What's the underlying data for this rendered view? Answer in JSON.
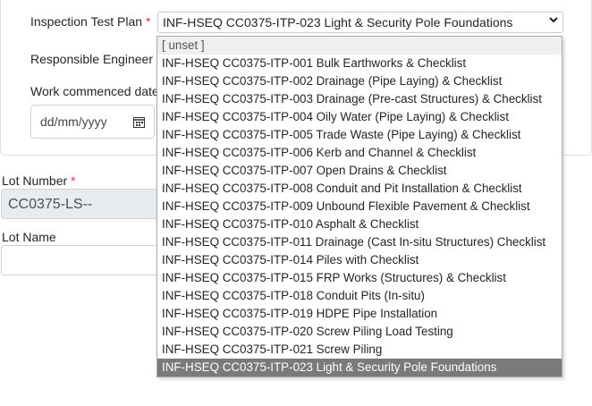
{
  "form": {
    "itp_label": "Inspection Test Plan",
    "required_mark": "*",
    "itp_value": "INF-HSEQ CC0375-ITP-023 Light & Security Pole Foundations",
    "engineer_label": "Responsible Engineer",
    "work_label": "Work commenced date",
    "date_placeholder": "dd/mm/yyyy",
    "lot_number_label": "Lot Number",
    "lot_number_value": "CC0375-LS--",
    "lot_name_label": "Lot Name"
  },
  "dropdown": {
    "options": [
      "[ unset ]",
      "INF-HSEQ CC0375-ITP-001 Bulk Earthworks & Checklist",
      "INF-HSEQ CC0375-ITP-002 Drainage (Pipe Laying) & Checklist",
      "INF-HSEQ CC0375-ITP-003 Drainage (Pre-cast Structures) & Checklist",
      "INF-HSEQ CC0375-ITP-004 Oily Water (Pipe Laying) & Checklist",
      "INF-HSEQ CC0375-ITP-005 Trade Waste (Pipe Laying) & Checklist",
      "INF-HSEQ CC0375-ITP-006 Kerb and Channel & Checklist",
      "INF-HSEQ CC0375-ITP-007 Open Drains & Checklist",
      "INF-HSEQ CC0375-ITP-008 Conduit and Pit Installation & Checklist",
      "INF-HSEQ CC0375-ITP-009 Unbound Flexible Pavement & Checklist",
      "INF-HSEQ CC0375-ITP-010 Asphalt & Checklist",
      "INF-HSEQ CC0375-ITP-011 Drainage (Cast In-situ Structures) Checklist",
      "INF-HSEQ CC0375-ITP-014 Piles with Checklist",
      "INF-HSEQ CC0375-ITP-015 FRP Works (Structures) & Checklist",
      "INF-HSEQ CC0375-ITP-018 Conduit Pits (In-situ)",
      "INF-HSEQ CC0375-ITP-019 HDPE Pipe Installation",
      "INF-HSEQ CC0375-ITP-020 Screw Piling Load Testing",
      "INF-HSEQ CC0375-ITP-021 Screw Piling",
      "INF-HSEQ CC0375-ITP-023 Light & Security Pole Foundations"
    ]
  }
}
